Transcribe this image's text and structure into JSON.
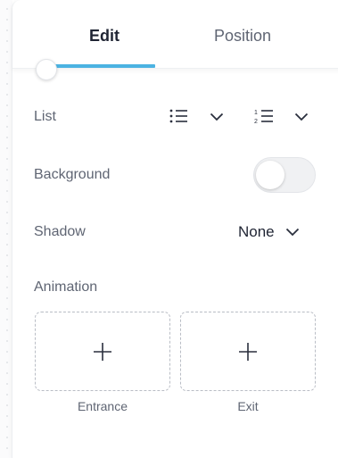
{
  "tabs": {
    "edit_label": "Edit",
    "position_label": "Position",
    "active": "Edit"
  },
  "list": {
    "label": "List",
    "bullet_icon": "bulleted-list-icon",
    "numbered_icon": "numbered-list-icon"
  },
  "background": {
    "label": "Background",
    "enabled": false
  },
  "shadow": {
    "label": "Shadow",
    "value": "None"
  },
  "animation": {
    "label": "Animation",
    "entrance_label": "Entrance",
    "exit_label": "Exit"
  },
  "colors": {
    "accent": "#4bb3e2",
    "text_dark": "#1f2433",
    "text_muted": "#5f6573"
  }
}
